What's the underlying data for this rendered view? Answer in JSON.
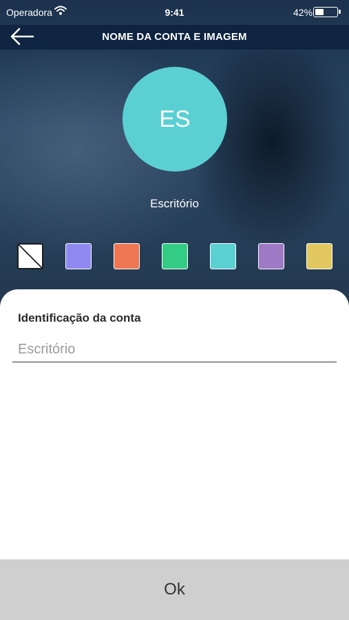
{
  "status_bar": {
    "carrier": "Operadora",
    "time": "9:41",
    "battery_percent": "42%",
    "battery_level": 0.42
  },
  "header": {
    "back_icon": "arrow-left-icon",
    "title": "NOME DA CONTA E IMAGEM"
  },
  "avatar": {
    "initials": "ES",
    "color": "#5bd0d3"
  },
  "account_name": "Escritório",
  "color_swatches": [
    {
      "name": "none",
      "color": "#ffffff"
    },
    {
      "name": "lavender",
      "color": "#8f89ef"
    },
    {
      "name": "orange",
      "color": "#ee7752"
    },
    {
      "name": "green",
      "color": "#33cc84"
    },
    {
      "name": "turquoise",
      "color": "#5bd0d3"
    },
    {
      "name": "purple",
      "color": "#9e79c4"
    },
    {
      "name": "yellow",
      "color": "#e2c75e"
    }
  ],
  "form": {
    "label": "Identificação da conta",
    "placeholder": "Escritório",
    "value": ""
  },
  "ok_button": {
    "label": "Ok"
  }
}
